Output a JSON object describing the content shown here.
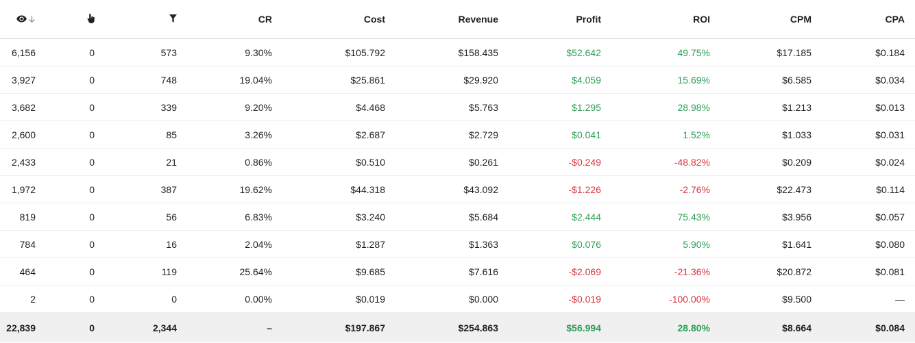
{
  "header": {
    "views_icon": "eye-icon",
    "sort_icon": "arrow-down-icon",
    "clicks_icon": "pointer-hand-icon",
    "conversions_icon": "funnel-icon",
    "cr": "CR",
    "cost": "Cost",
    "revenue": "Revenue",
    "profit": "Profit",
    "roi": "ROI",
    "cpm": "CPM",
    "cpa": "CPA"
  },
  "colors": {
    "positive": "#2e9e55",
    "negative": "#d9363e"
  },
  "rows": [
    {
      "views": "6,156",
      "clicks": "0",
      "conversions": "573",
      "cr": "9.30%",
      "cost": "$105.792",
      "revenue": "$158.435",
      "profit": "$52.642",
      "roi": "49.75%",
      "cpm": "$17.185",
      "cpa": "$0.184",
      "sign": "pos"
    },
    {
      "views": "3,927",
      "clicks": "0",
      "conversions": "748",
      "cr": "19.04%",
      "cost": "$25.861",
      "revenue": "$29.920",
      "profit": "$4.059",
      "roi": "15.69%",
      "cpm": "$6.585",
      "cpa": "$0.034",
      "sign": "pos"
    },
    {
      "views": "3,682",
      "clicks": "0",
      "conversions": "339",
      "cr": "9.20%",
      "cost": "$4.468",
      "revenue": "$5.763",
      "profit": "$1.295",
      "roi": "28.98%",
      "cpm": "$1.213",
      "cpa": "$0.013",
      "sign": "pos"
    },
    {
      "views": "2,600",
      "clicks": "0",
      "conversions": "85",
      "cr": "3.26%",
      "cost": "$2.687",
      "revenue": "$2.729",
      "profit": "$0.041",
      "roi": "1.52%",
      "cpm": "$1.033",
      "cpa": "$0.031",
      "sign": "pos"
    },
    {
      "views": "2,433",
      "clicks": "0",
      "conversions": "21",
      "cr": "0.86%",
      "cost": "$0.510",
      "revenue": "$0.261",
      "profit": "-$0.249",
      "roi": "-48.82%",
      "cpm": "$0.209",
      "cpa": "$0.024",
      "sign": "neg"
    },
    {
      "views": "1,972",
      "clicks": "0",
      "conversions": "387",
      "cr": "19.62%",
      "cost": "$44.318",
      "revenue": "$43.092",
      "profit": "-$1.226",
      "roi": "-2.76%",
      "cpm": "$22.473",
      "cpa": "$0.114",
      "sign": "neg"
    },
    {
      "views": "819",
      "clicks": "0",
      "conversions": "56",
      "cr": "6.83%",
      "cost": "$3.240",
      "revenue": "$5.684",
      "profit": "$2.444",
      "roi": "75.43%",
      "cpm": "$3.956",
      "cpa": "$0.057",
      "sign": "pos"
    },
    {
      "views": "784",
      "clicks": "0",
      "conversions": "16",
      "cr": "2.04%",
      "cost": "$1.287",
      "revenue": "$1.363",
      "profit": "$0.076",
      "roi": "5.90%",
      "cpm": "$1.641",
      "cpa": "$0.080",
      "sign": "pos"
    },
    {
      "views": "464",
      "clicks": "0",
      "conversions": "119",
      "cr": "25.64%",
      "cost": "$9.685",
      "revenue": "$7.616",
      "profit": "-$2.069",
      "roi": "-21.36%",
      "cpm": "$20.872",
      "cpa": "$0.081",
      "sign": "neg"
    },
    {
      "views": "2",
      "clicks": "0",
      "conversions": "0",
      "cr": "0.00%",
      "cost": "$0.019",
      "revenue": "$0.000",
      "profit": "-$0.019",
      "roi": "-100.00%",
      "cpm": "$9.500",
      "cpa": "—",
      "sign": "neg"
    }
  ],
  "total": {
    "views": "22,839",
    "clicks": "0",
    "conversions": "2,344",
    "cr": "–",
    "cost": "$197.867",
    "revenue": "$254.863",
    "profit": "$56.994",
    "roi": "28.80%",
    "cpm": "$8.664",
    "cpa": "$0.084",
    "sign": "pos"
  }
}
